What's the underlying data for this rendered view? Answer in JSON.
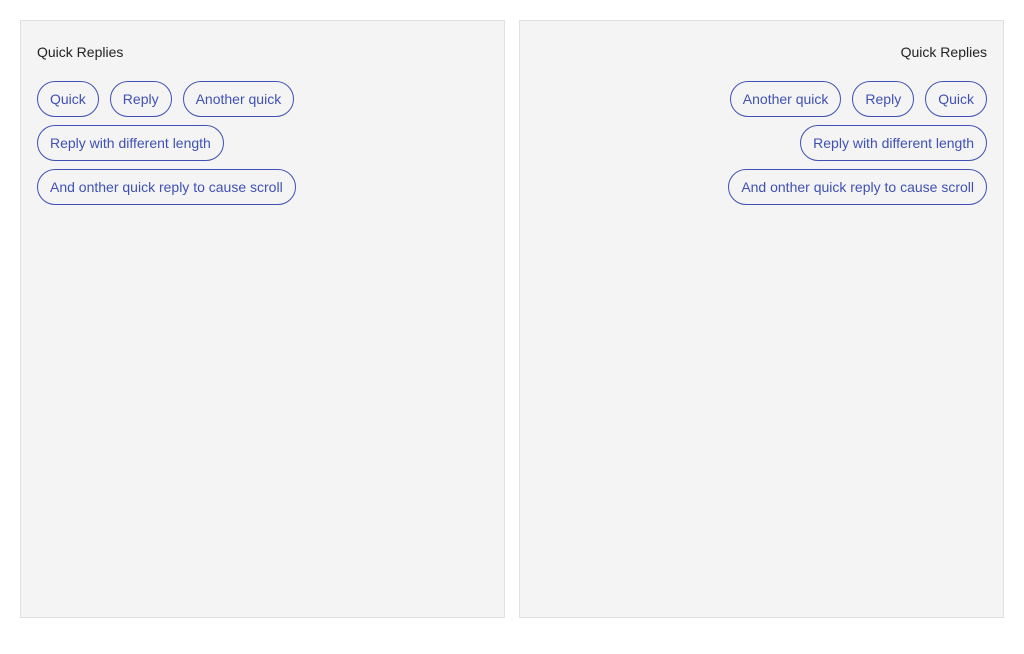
{
  "left_panel": {
    "title": "Quick Replies",
    "replies": [
      "Quick",
      "Reply",
      "Another quick",
      "Reply with different length",
      "And onther quick reply to cause scroll"
    ]
  },
  "right_panel": {
    "title": "Quick Replies",
    "replies": [
      "Quick",
      "Reply",
      "Another quick",
      "Reply with different length",
      "And onther quick reply to cause scroll"
    ]
  },
  "colors": {
    "accent": "#3f51b5",
    "panel_background": "#f4f4f4",
    "text": "#222222"
  }
}
